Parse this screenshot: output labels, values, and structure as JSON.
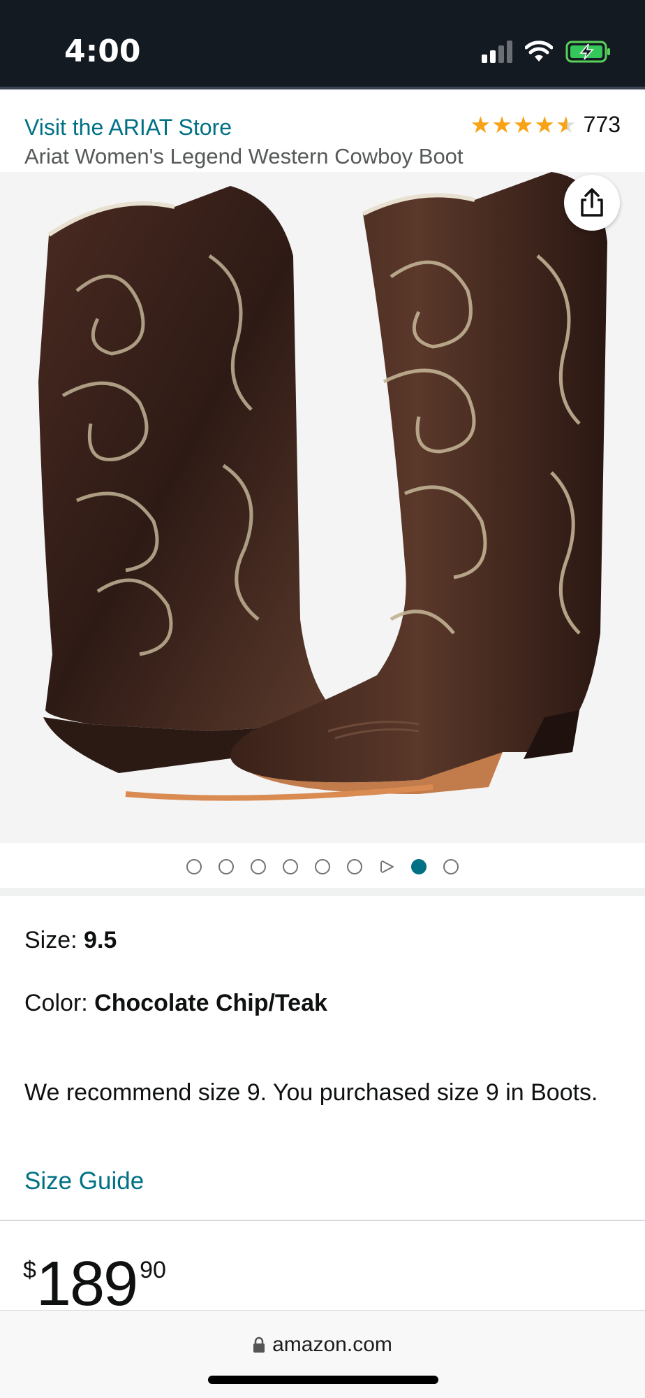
{
  "status_bar": {
    "time": "4:00",
    "icons": [
      "signal-icon",
      "wifi-icon",
      "battery-charging-icon"
    ]
  },
  "store": {
    "link_text": "Visit the ARIAT Store",
    "rating_stars": 4.5,
    "rating_count": "773"
  },
  "product": {
    "title": "Ariat Women's Legend Western Cowboy Boot"
  },
  "gallery": {
    "image_count": 9,
    "video_index": 7,
    "active_index": 8,
    "icons": [
      "share-icon"
    ]
  },
  "options": {
    "size_label": "Size: ",
    "size_value": "9.5",
    "color_label": "Color: ",
    "color_value": "Chocolate Chip/Teak",
    "recommendation": "We recommend size 9. You purchased size 9 in Boots.",
    "size_guide": "Size Guide"
  },
  "price": {
    "symbol": "$",
    "whole": "189",
    "fraction": "90"
  },
  "browser": {
    "url": "amazon.com",
    "icons": [
      "lock-icon"
    ]
  },
  "colors": {
    "link": "#007185",
    "star": "#f7a315",
    "status_bg": "#131a22"
  }
}
